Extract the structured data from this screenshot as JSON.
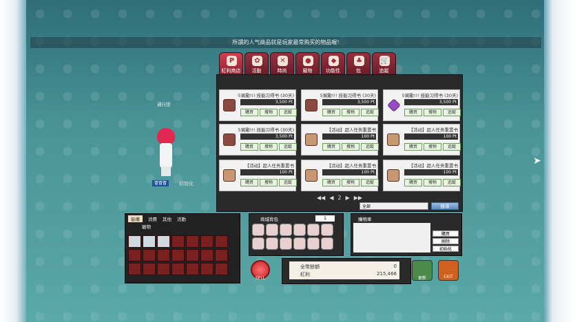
{
  "announcement": "所謂的人气商品就是玩家最常购买的物品喔!",
  "tabs": [
    {
      "label": "紅利商店",
      "icon": "P"
    },
    {
      "label": "活動",
      "icon": "✿"
    },
    {
      "label": "時尚",
      "icon": "✕"
    },
    {
      "label": "寵物",
      "icon": "●"
    },
    {
      "label": "功能性",
      "icon": "◆"
    },
    {
      "label": "包",
      "icon": "♣"
    },
    {
      "label": "追蹤",
      "icon": "🛒"
    }
  ],
  "items": [
    {
      "name": "5貿勵!!! 技能习得书 (30天)",
      "price": "3,500",
      "pic": "book"
    },
    {
      "name": "5貿勵!!! 技能习得书 (30天)",
      "price": "3,500",
      "pic": "book"
    },
    {
      "name": "5貿勵!!! 技能习得书 (30天)",
      "price": "3,500",
      "pic": "purple"
    },
    {
      "name": "5貿勵!!! 技能习得书 (30天)",
      "price": "3,500",
      "pic": "book"
    },
    {
      "name": "【活动】超人任务重置书",
      "price": "100",
      "pic": "cake"
    },
    {
      "name": "【活动】超人任务重置书",
      "price": "100",
      "pic": "cake"
    },
    {
      "name": "【活动】超人任务重置书",
      "price": "100",
      "pic": "cake"
    },
    {
      "name": "【活动】超人任务重置书",
      "price": "100",
      "pic": "cake"
    },
    {
      "name": "【活动】超人任务重置书",
      "price": "100",
      "pic": "cake"
    }
  ],
  "price_unit": "Pt",
  "buttons": {
    "buy": "購買",
    "gift": "擭物",
    "track": "追蹤"
  },
  "pager": {
    "current": "2",
    "first": "◀◀",
    "prev": "◀",
    "next": "▶",
    "last": "▶▶"
  },
  "filter": {
    "value": "全部"
  },
  "search_label": "搜尋",
  "inventory": {
    "tabs": [
      "裝備",
      "消費",
      "其他",
      "活動",
      "寵物"
    ],
    "active_tab": "裝備"
  },
  "cash_bag": {
    "title": "商城背包",
    "page": "1"
  },
  "cart": {
    "title": "購物車",
    "buttons": [
      "購買",
      "刪除",
      "初始化"
    ]
  },
  "money": {
    "rows": [
      {
        "label": "全幣餘額",
        "value": "0"
      },
      {
        "label": "紅利",
        "value": "215,466"
      }
    ]
  },
  "sell_label": "SELL",
  "update_label": "更新",
  "exit_label": "EXIT",
  "character": {
    "name": "冒冒冒",
    "tag": "初始化",
    "floating": "通行證"
  }
}
